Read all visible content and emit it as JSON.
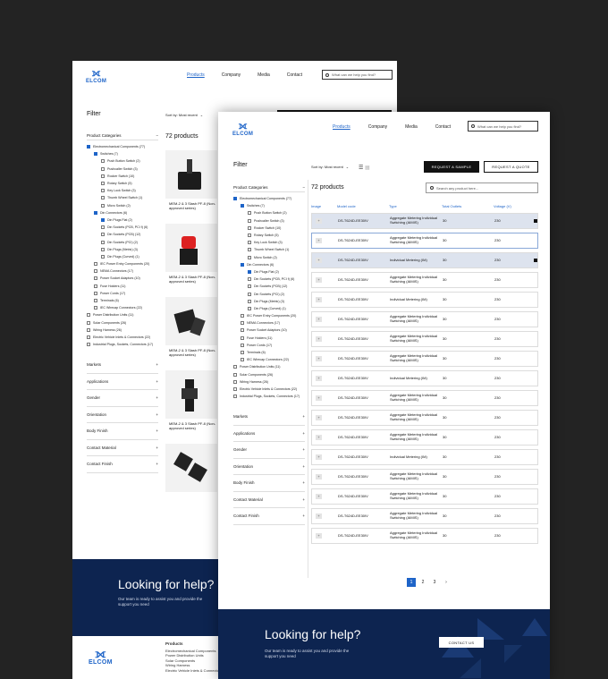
{
  "brand": {
    "name": "ELCOM",
    "color": "#1e64c8"
  },
  "nav": {
    "items": [
      "Products",
      "Company",
      "Media",
      "Contact"
    ],
    "active": "Products"
  },
  "search": {
    "placeholder": "What can we help you find?"
  },
  "sort": {
    "label": "Sort by: Most recent"
  },
  "filter": {
    "title": "Filter",
    "categories_title": "Product Categories",
    "tree": [
      {
        "label": "Electromechanical Components (77)",
        "level": 0,
        "checked": true
      },
      {
        "label": "Switches (7)",
        "level": 1,
        "checked": true
      },
      {
        "label": "Push Button Switch (2)",
        "level": 2,
        "checked": false
      },
      {
        "label": "Pushcaller Switch (3)",
        "level": 2,
        "checked": false
      },
      {
        "label": "Rocker Switch (10)",
        "level": 2,
        "checked": false
      },
      {
        "label": "Rotary Switch (5)",
        "level": 2,
        "checked": false
      },
      {
        "label": "Key Lock Switch (3)",
        "level": 2,
        "checked": false
      },
      {
        "label": "Thumb Wheel Switch (1)",
        "level": 2,
        "checked": false
      },
      {
        "label": "Micro Switch (2)",
        "level": 2,
        "checked": false
      },
      {
        "label": "Din Connectors (6)",
        "level": 1,
        "checked": true
      },
      {
        "label": "Din Plugs Flat (2)",
        "level": 2,
        "checked": true
      },
      {
        "label": "Din Sockets (PCB, PCI f) (6)",
        "level": 2,
        "checked": false
      },
      {
        "label": "Din Sockets (PCB) (12)",
        "level": 2,
        "checked": false
      },
      {
        "label": "Din Sockets (PCI) (2)",
        "level": 2,
        "checked": false
      },
      {
        "label": "Din Plugs (Metric) (3)",
        "level": 2,
        "checked": false
      },
      {
        "label": "Din Plugs (Curved) (1)",
        "level": 2,
        "checked": false
      },
      {
        "label": "IEC Power Entry Components (20)",
        "level": 1,
        "checked": false
      },
      {
        "label": "NEMA Connectors (17)",
        "level": 1,
        "checked": false
      },
      {
        "label": "Power Socket Adaptors (10)",
        "level": 1,
        "checked": false
      },
      {
        "label": "Fuse Holders (11)",
        "level": 1,
        "checked": false
      },
      {
        "label": "Power Cords (17)",
        "level": 1,
        "checked": false
      },
      {
        "label": "Terminals (6)",
        "level": 1,
        "checked": false
      },
      {
        "label": "IEC Wirecap Connectors (22)",
        "level": 1,
        "checked": false
      },
      {
        "label": "Power Distribution Units (11)",
        "level": 0,
        "checked": false
      },
      {
        "label": "Solar Components (26)",
        "level": 0,
        "checked": false
      },
      {
        "label": "Wiring Harness (26)",
        "level": 0,
        "checked": false
      },
      {
        "label": "Electric Vehicle Inlets & Connectors (22)",
        "level": 0,
        "checked": false
      },
      {
        "label": "Industrial Plugs, Sockets, Connectors (17)",
        "level": 0,
        "checked": false
      }
    ],
    "facets": [
      "Markets",
      "Applications",
      "Gender",
      "Orientation",
      "Body Finish",
      "Contact Material",
      "Contact Finish"
    ]
  },
  "results": {
    "count_label": "72 products",
    "search_placeholder": "Search any product here..."
  },
  "actions": {
    "sample": "REQUEST A SAMPLE",
    "quote": "REQUEST A QUOTE"
  },
  "products": [
    {
      "caption": "MEM-2 & 3 Slash PF-8 (Non-approved series)"
    },
    {
      "caption": "MEM-2 & 3 Slash PF-8 (Non-approved series)"
    },
    {
      "caption": "MEM-2 & 3 Slash PF-8 (Non-approved series)"
    },
    {
      "caption": "MEM-2 & 3 Slash PF-8 (Non-approved series)"
    }
  ],
  "table": {
    "headers": [
      "Image",
      "Model code",
      "Type",
      "Total Outlets",
      "Voltage (V)"
    ],
    "rows": [
      {
        "model": "DS-T624D-EE30IV",
        "type": "Aggregate Metering Individual Switching (AIMIS)",
        "outlets": "30",
        "voltage": "230",
        "state": "selected"
      },
      {
        "model": "DS-T624D-EE30IV",
        "type": "Aggregate Metering Individual Switching (AIMIS)",
        "outlets": "30",
        "voltage": "230",
        "state": "highlighted"
      },
      {
        "model": "DS-T624D-EE30IV",
        "type": "Individual Metering (IM)",
        "outlets": "30",
        "voltage": "230",
        "state": "selected"
      },
      {
        "model": "DS-T624D-EE30IV",
        "type": "Aggregate Metering Individual Switching (AIMIS)",
        "outlets": "30",
        "voltage": "230",
        "state": ""
      },
      {
        "model": "DS-T624D-EE30IV",
        "type": "Individual Metering (IM)",
        "outlets": "30",
        "voltage": "230",
        "state": ""
      },
      {
        "model": "DS-T624D-EE30IV",
        "type": "Aggregate Metering Individual Switching (AIMIS)",
        "outlets": "30",
        "voltage": "230",
        "state": ""
      },
      {
        "model": "DS-T624D-EE30IV",
        "type": "Aggregate Metering Individual Switching (AIMIS)",
        "outlets": "30",
        "voltage": "230",
        "state": ""
      },
      {
        "model": "DS-T624D-EE30IV",
        "type": "Aggregate Metering Individual Switching (AIMIS)",
        "outlets": "30",
        "voltage": "230",
        "state": ""
      },
      {
        "model": "DS-T624D-EE30IV",
        "type": "Individual Metering (IM)",
        "outlets": "30",
        "voltage": "230",
        "state": ""
      },
      {
        "model": "DS-T624D-EE30IV",
        "type": "Aggregate Metering Individual Switching (AIMIS)",
        "outlets": "30",
        "voltage": "230",
        "state": ""
      },
      {
        "model": "DS-T624D-EE30IV",
        "type": "Aggregate Metering Individual Switching (AIMIS)",
        "outlets": "30",
        "voltage": "230",
        "state": ""
      },
      {
        "model": "DS-T624D-EE30IV",
        "type": "Aggregate Metering Individual Switching (AIMIS)",
        "outlets": "30",
        "voltage": "230",
        "state": ""
      },
      {
        "model": "DS-T624D-EE30IV",
        "type": "Individual Metering (IM)",
        "outlets": "30",
        "voltage": "230",
        "state": ""
      },
      {
        "model": "DS-T624D-EE30IV",
        "type": "Aggregate Metering Individual Switching (AIMIS)",
        "outlets": "30",
        "voltage": "230",
        "state": ""
      },
      {
        "model": "DS-T624D-EE30IV",
        "type": "Aggregate Metering Individual Switching (AIMIS)",
        "outlets": "30",
        "voltage": "230",
        "state": ""
      },
      {
        "model": "DS-T624D-EE30IV",
        "type": "Aggregate Metering Individual Switching (AIMIS)",
        "outlets": "30",
        "voltage": "230",
        "state": ""
      },
      {
        "model": "DS-T624D-EE30IV",
        "type": "Aggregate Metering Individual Switching (AIMIS)",
        "outlets": "30",
        "voltage": "230",
        "state": ""
      }
    ]
  },
  "pagination": {
    "pages": [
      "1",
      "2",
      "3"
    ],
    "current": "1",
    "next": "›"
  },
  "footer": {
    "heading": "Looking for help?",
    "text": "Our team is ready to assist you and provide the support you need",
    "cta": "CONTACT US",
    "products_title": "Products",
    "products": [
      "Electromechanical Components",
      "Power Distribution Units",
      "Solar Components",
      "Wiring Harness",
      "Electric Vehicle Inlets & Connectors"
    ]
  }
}
